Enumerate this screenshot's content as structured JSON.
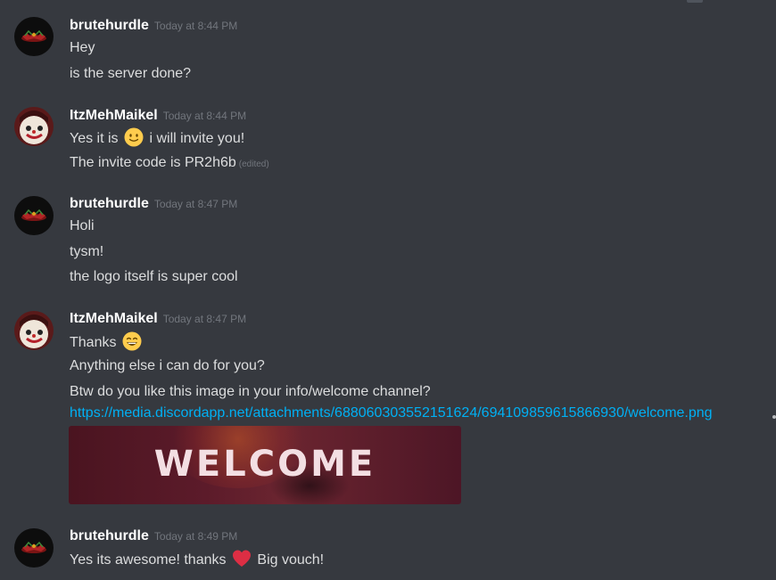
{
  "messages": [
    {
      "author": "brutehurdle",
      "timestamp": "Today at 8:44 PM",
      "lines": [
        "Hey",
        "is the server done?"
      ]
    },
    {
      "author": "ItzMehMaikel",
      "timestamp": "Today at 8:44 PM",
      "line1_before": "Yes it is",
      "line1_after": "i will invite you!",
      "line2": "The invite code is PR2h6b",
      "line2_edited": "(edited)"
    },
    {
      "author": "brutehurdle",
      "timestamp": "Today at 8:47 PM",
      "lines": [
        "Holi",
        "tysm!",
        "the logo itself is super cool"
      ]
    },
    {
      "author": "ItzMehMaikel",
      "timestamp": "Today at 8:47 PM",
      "line1": "Thanks",
      "line2": "Anything else i can do for you?",
      "line3": "Btw do you like this image in your info/welcome channel?",
      "link": "https://media.discordapp.net/attachments/688060303552151624/694109859615866930/welcome.png",
      "image_text": "WELCOME"
    },
    {
      "author": "brutehurdle",
      "timestamp": "Today at 8:49 PM",
      "line_before": "Yes its awesome! thanks",
      "line_after": "Big vouch!"
    }
  ],
  "icons": {
    "slight_smile": "slightly-smiling-face-emoji",
    "smile": "grinning-face-emoji",
    "heart": "red-heart-emoji"
  },
  "colors": {
    "background": "#36393f",
    "username": "#ffffff",
    "text": "#dcddde",
    "timestamp": "#72767d",
    "link": "#00b0f4"
  }
}
